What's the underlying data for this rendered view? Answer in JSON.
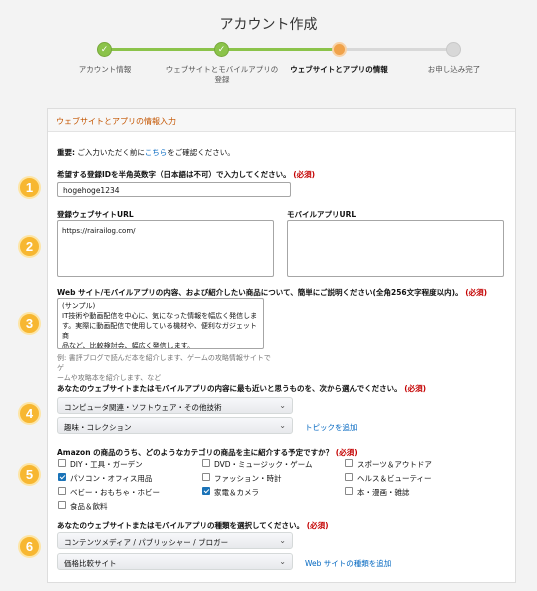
{
  "page_title": "アカウント作成",
  "steps": [
    {
      "label": "アカウント情報",
      "status": "done"
    },
    {
      "label": "ウェブサイトとモバイルアプリの登録",
      "status": "done"
    },
    {
      "label": "ウェブサイトとアプリの情報",
      "status": "current"
    },
    {
      "label": "お申し込み完了",
      "status": "todo"
    }
  ],
  "colors": {
    "accent": "#c45500",
    "done": "#8bc34a",
    "current": "#f0a24a",
    "badge": "#f7b731",
    "link": "#0066c0",
    "required": "#c40000"
  },
  "panel": {
    "heading": "ウェブサイトとアプリの情報入力",
    "important_label": "重要:",
    "important_pre": " ご入力いただく前に",
    "important_link": "こちら",
    "important_post": "をご確認ください。"
  },
  "required_tag": "(必須)",
  "badges": [
    "1",
    "2",
    "3",
    "4",
    "5",
    "6"
  ],
  "store_id": {
    "label": "希望する登録IDを半角英数字（日本語は不可）で入力してください。",
    "value": "hogehoge1234"
  },
  "website_url": {
    "label": "登録ウェブサイトURL",
    "value": "https://rairailog.com/"
  },
  "mobile_app_url": {
    "label": "モバイルアプリURL",
    "value": ""
  },
  "description": {
    "label": "Web サイト/モバイルアプリの内容、および紹介したい商品について、簡単にご説明ください(全角256文字程度以内)。",
    "lines": [
      "(サンプル)",
      "IT技術や動画配信を中心に、気になった情報を幅広く発信しま",
      "す。実際に動画配信で使用している機材や、便利なガジェット商",
      "品など、比較検討会、幅広く発信します。"
    ],
    "hint_line1": "例: 書評ブログで読んだ本を紹介します、ゲームの攻略情報サイトでゲ",
    "hint_line2": "ームや攻略本を紹介します、など"
  },
  "topics": {
    "label": "あなたのウェブサイトまたはモバイルアプリの内容に最も近いと思うものを、次から選んでください。",
    "select1": "コンピュータ関連・ソフトウェア・その他技術",
    "select2": "趣味・コレクション",
    "add_link": "トピックを追加"
  },
  "categories": {
    "label": "Amazon の商品のうち、どのようなカテゴリの商品を主に紹介する予定ですか？",
    "items": [
      {
        "label": "DIY・工具・ガーデン",
        "checked": false
      },
      {
        "label": "DVD・ミュージック・ゲーム",
        "checked": false
      },
      {
        "label": "スポーツ＆アウトドア",
        "checked": false
      },
      {
        "label": "パソコン・オフィス用品",
        "checked": true
      },
      {
        "label": "ファッション・時計",
        "checked": false
      },
      {
        "label": "ヘルス＆ビューティー",
        "checked": false
      },
      {
        "label": "ベビー・おもちゃ・ホビー",
        "checked": false
      },
      {
        "label": "家電＆カメラ",
        "checked": true
      },
      {
        "label": "本・漫画・雑誌",
        "checked": false
      },
      {
        "label": "食品＆飲料",
        "checked": false
      }
    ]
  },
  "site_types": {
    "label": "あなたのウェブサイトまたはモバイルアプリの種類を選択してください。",
    "select1": "コンテンツメディア / パブリッシャー / ブロガー",
    "select2": "価格比較サイト",
    "add_link": "Web サイトの種類を追加"
  }
}
